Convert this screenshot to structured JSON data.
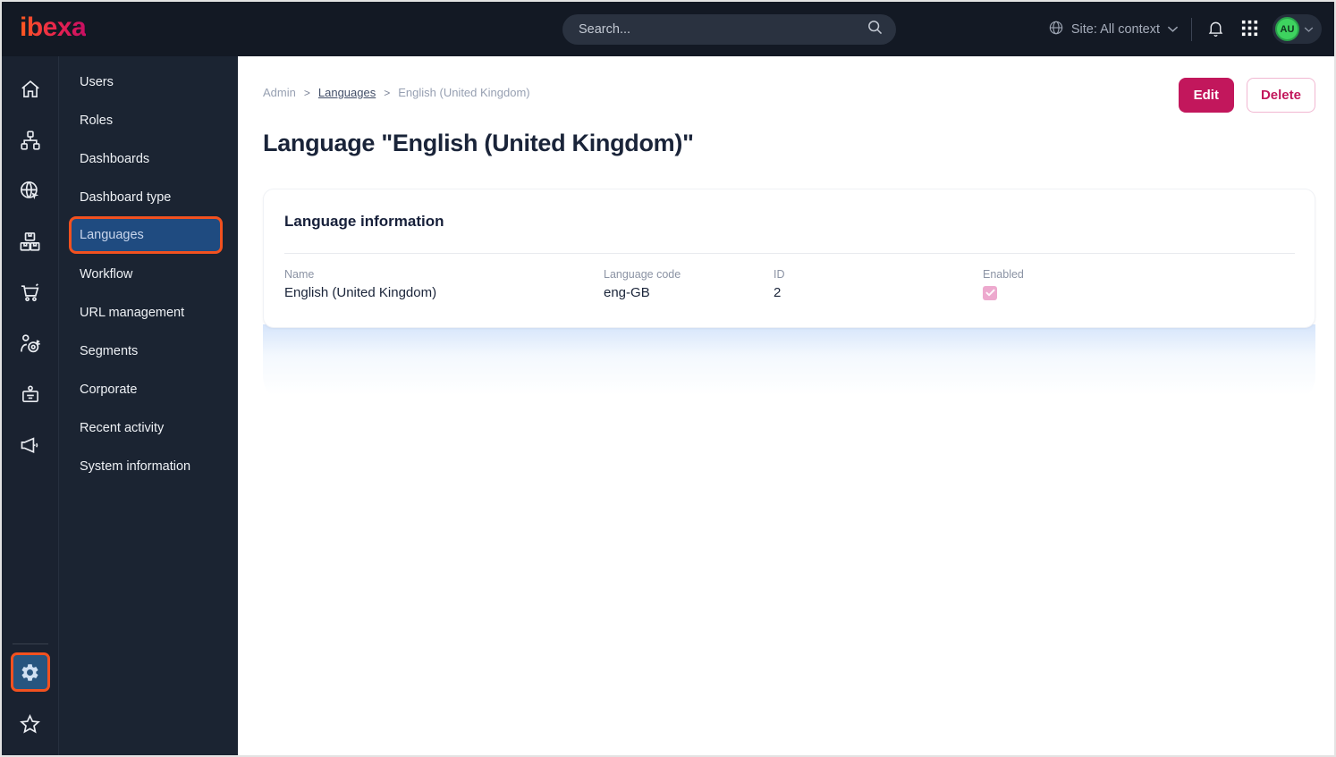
{
  "topbar": {
    "logo_text": "ibexa",
    "search_placeholder": "Search...",
    "site_context_label": "Site: All context",
    "avatar_initials": "AU",
    "icons": [
      "search-icon",
      "globe-icon",
      "chevron-down-icon",
      "bell-icon",
      "apps-grid-icon"
    ]
  },
  "icon_rail": {
    "items": [
      {
        "icon": "home-icon"
      },
      {
        "icon": "content-tree-icon"
      },
      {
        "icon": "site-globe-icon"
      },
      {
        "icon": "products-boxes-icon"
      },
      {
        "icon": "cart-icon"
      },
      {
        "icon": "audience-target-icon"
      },
      {
        "icon": "id-badge-icon"
      },
      {
        "icon": "megaphone-icon"
      }
    ],
    "bottom_items": [
      {
        "icon": "gear-icon",
        "active": true,
        "highlight": "orange annotation box"
      },
      {
        "icon": "star-icon"
      }
    ]
  },
  "sidebar": {
    "items": [
      {
        "label": "Users"
      },
      {
        "label": "Roles"
      },
      {
        "label": "Dashboards"
      },
      {
        "label": "Dashboard type"
      },
      {
        "label": "Languages",
        "active": true,
        "highlight": "orange annotation box"
      },
      {
        "label": "Workflow"
      },
      {
        "label": "URL management"
      },
      {
        "label": "Segments"
      },
      {
        "label": "Corporate"
      },
      {
        "label": "Recent activity"
      },
      {
        "label": "System information"
      }
    ]
  },
  "breadcrumb": {
    "separator": ">",
    "items": [
      {
        "label": "Admin"
      },
      {
        "label": "Languages",
        "link": true
      },
      {
        "label": "English (United Kingdom)"
      }
    ]
  },
  "actions": {
    "edit_label": "Edit",
    "delete_label": "Delete"
  },
  "page": {
    "title": "Language \"English (United Kingdom)\""
  },
  "card": {
    "heading": "Language information",
    "fields": [
      {
        "label": "Name",
        "value": "English (United Kingdom)"
      },
      {
        "label": "Language code",
        "value": "eng-GB"
      },
      {
        "label": "ID",
        "value": "2"
      },
      {
        "label": "Enabled",
        "checked": true
      }
    ]
  },
  "colors": {
    "accent_pink": "#c2175c",
    "annotation_orange": "#f2511f",
    "active_blue": "#1f4b80",
    "avatar_green": "#3ed35f",
    "topbar_bg": "#131924",
    "sidebar_bg": "#1b2432",
    "checkbox_pink": "#eda9ce"
  }
}
